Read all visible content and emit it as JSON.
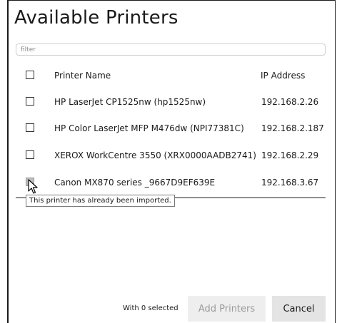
{
  "dialog": {
    "title": "Available Printers",
    "filter_placeholder": "filter",
    "columns": {
      "name": "Printer Name",
      "ip": "IP Address"
    },
    "printers": [
      {
        "name": "HP LaserJet CP1525nw (hp1525nw)",
        "ip": "192.168.2.26",
        "checked": false,
        "disabled": false
      },
      {
        "name": "HP Color LaserJet MFP M476dw (NPI77381C)",
        "ip": "192.168.2.187",
        "checked": false,
        "disabled": false
      },
      {
        "name": "XEROX WorkCentre 3550 (XRX0000AADB2741)",
        "ip": "192.168.2.29",
        "checked": false,
        "disabled": false
      },
      {
        "name": "Canon MX870 series _9667D9EF639E",
        "ip": "192.168.3.67",
        "checked": false,
        "disabled": true
      }
    ],
    "tooltip": "This printer has already been imported.",
    "selected_text": "With 0 selected",
    "add_button": "Add Printers",
    "cancel_button": "Cancel"
  },
  "colors": {
    "disabled_checkbox": "#bdbdbd",
    "button_bg": "#e4e4e4",
    "disabled_text": "#9a9a9a"
  },
  "icons": {
    "cursor": "arrow-cursor-icon"
  }
}
